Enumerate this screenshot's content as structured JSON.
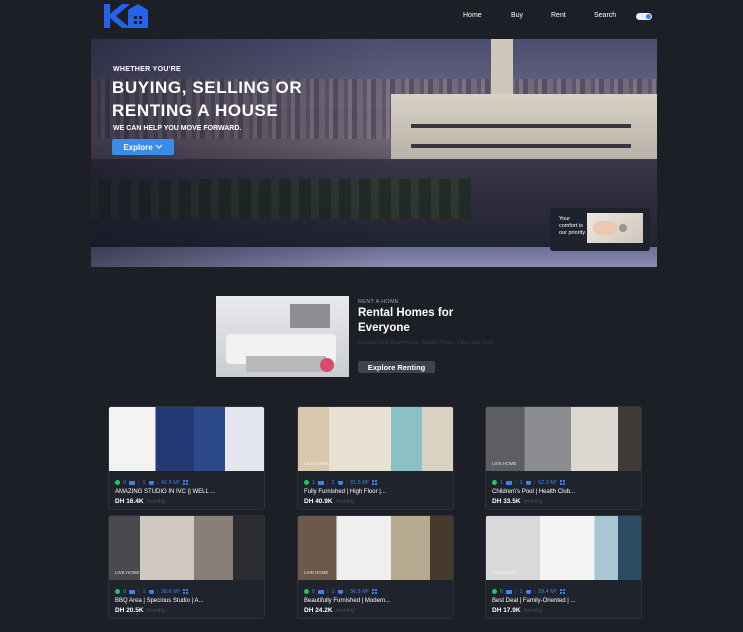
{
  "nav": {
    "links": [
      "Home",
      "Buy",
      "Rent",
      "Search"
    ]
  },
  "hero": {
    "kicker": "WHETHER YOU'RE",
    "headline_1": "BUYING, SELLING OR",
    "headline_2": "RENTING A HOUSE",
    "sub": "WE CAN HELP YOU MOVE FORWARD.",
    "explore_label": "Explore",
    "comfort_text": "Your comfort is our priority."
  },
  "rent_section": {
    "label": "RENT A HOME",
    "title": "Rental Homes for Everyone",
    "description": "Explore from Apartments, Builder floors, villas and more",
    "button_label": "Explore Renting"
  },
  "listings": [
    {
      "title": "AMAZING STUDIO IN IVC || WELL ...",
      "price": "DH 16.4K",
      "period": "/monthly",
      "available": "0",
      "beds": "1",
      "baths": "42.5 M²",
      "brand": ""
    },
    {
      "title": "Fully Furnished | High Floor |...",
      "price": "DH 40.9K",
      "period": "/monthly",
      "available": "1",
      "beds": "2",
      "baths": "81.5 M²",
      "brand": "LIVE HOME"
    },
    {
      "title": "Children\\'s Pool | Health Club...",
      "price": "DH 33.5K",
      "period": "/monthly",
      "available": "1",
      "beds": "1",
      "baths": "62.3 M²",
      "brand": "LIVE HOME"
    },
    {
      "title": "BBQ Area | Specious Studio | A...",
      "price": "DH 20.5K",
      "period": "/monthly",
      "available": "0",
      "beds": "1",
      "baths": "38.6 M²",
      "brand": "LIVE HOME"
    },
    {
      "title": "Beautifully Furnished | Modern...",
      "price": "DH 24.2K",
      "period": "/monthly",
      "available": "0",
      "beds": "1",
      "baths": "36.5 M²",
      "brand": "LIVE HOME"
    },
    {
      "title": "Best Deal | Family-Oriented | ...",
      "price": "DH 17.9K",
      "period": "/monthly",
      "available": "0",
      "beds": "1",
      "baths": "29.4 M²",
      "brand": "LIVE HOME"
    }
  ],
  "colors": {
    "background": "#1c1f26",
    "accent": "#3b8beb",
    "card": "#1f232c",
    "ok": "#22c55e"
  },
  "icons": [
    "home-logo-icon",
    "chevron-down-icon",
    "check-circle-icon",
    "bed-icon",
    "bath-icon",
    "area-grid-icon"
  ]
}
